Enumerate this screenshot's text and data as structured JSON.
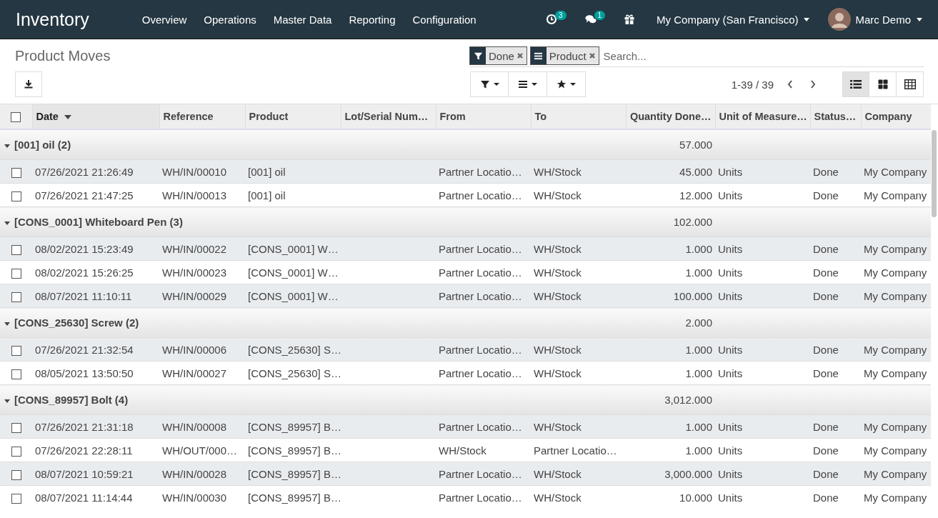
{
  "navbar": {
    "app_name": "Inventory",
    "menu": [
      "Overview",
      "Operations",
      "Master Data",
      "Reporting",
      "Configuration"
    ],
    "activity_count": "3",
    "message_count": "1",
    "company": "My Company (San Francisco)",
    "user": "Marc Demo"
  },
  "control_panel": {
    "title": "Product Moves",
    "facets": [
      {
        "kind": "filter",
        "label": "Done"
      },
      {
        "kind": "group",
        "label": "Product"
      }
    ],
    "search": {
      "placeholder": "Search..."
    },
    "pager": "1-39 / 39",
    "views": [
      {
        "kind": "list",
        "selected": true
      },
      {
        "kind": "kanban",
        "selected": false
      },
      {
        "kind": "pivot",
        "selected": false
      }
    ]
  },
  "table": {
    "select_all": {
      "checked": false
    },
    "columns": [
      {
        "label": "Date",
        "sorted": true
      },
      {
        "label": "Reference",
        "sorted": false
      },
      {
        "label": "Product",
        "sorted": false
      },
      {
        "label": "Lot/Serial Num…",
        "sorted": false
      },
      {
        "label": "From",
        "sorted": false
      },
      {
        "label": "To",
        "sorted": false
      },
      {
        "label": "Quantity Done…",
        "sorted": false
      },
      {
        "label": "Unit of Measure…",
        "sorted": false
      },
      {
        "label": "Status…",
        "sorted": false
      },
      {
        "label": "Company",
        "sorted": false
      }
    ],
    "groups": [
      {
        "label": "[001] oil (2)",
        "total": "57.000",
        "expanded": true,
        "rows": [
          {
            "checked": false,
            "date": "07/26/2021 21:26:49",
            "reference": "WH/IN/00010",
            "product": "[001] oil",
            "from": "Partner Locatio…",
            "to": "WH/Stock",
            "quantity": "45.000",
            "unit": "Units",
            "status": "Done",
            "company": "My Company"
          },
          {
            "checked": false,
            "date": "07/26/2021 21:47:25",
            "reference": "WH/IN/00013",
            "product": "[001] oil",
            "from": "Partner Locatio…",
            "to": "WH/Stock",
            "quantity": "12.000",
            "unit": "Units",
            "status": "Done",
            "company": "My Company"
          }
        ]
      },
      {
        "label": "[CONS_0001] Whiteboard Pen (3)",
        "total": "102.000",
        "expanded": true,
        "rows": [
          {
            "checked": false,
            "date": "08/02/2021 15:23:49",
            "reference": "WH/IN/00022",
            "product": "[CONS_0001] W…",
            "from": "Partner Locatio…",
            "to": "WH/Stock",
            "quantity": "1.000",
            "unit": "Units",
            "status": "Done",
            "company": "My Company"
          },
          {
            "checked": false,
            "date": "08/02/2021 15:26:25",
            "reference": "WH/IN/00023",
            "product": "[CONS_0001] W…",
            "from": "Partner Locatio…",
            "to": "WH/Stock",
            "quantity": "1.000",
            "unit": "Units",
            "status": "Done",
            "company": "My Company"
          },
          {
            "checked": false,
            "date": "08/07/2021 11:10:11",
            "reference": "WH/IN/00029",
            "product": "[CONS_0001] W…",
            "from": "Partner Locatio…",
            "to": "WH/Stock",
            "quantity": "100.000",
            "unit": "Units",
            "status": "Done",
            "company": "My Company"
          }
        ]
      },
      {
        "label": "[CONS_25630] Screw (2)",
        "total": "2.000",
        "expanded": true,
        "rows": [
          {
            "checked": false,
            "date": "07/26/2021 21:32:54",
            "reference": "WH/IN/00006",
            "product": "[CONS_25630] S…",
            "from": "Partner Locatio…",
            "to": "WH/Stock",
            "quantity": "1.000",
            "unit": "Units",
            "status": "Done",
            "company": "My Company"
          },
          {
            "checked": false,
            "date": "08/05/2021 13:50:50",
            "reference": "WH/IN/00027",
            "product": "[CONS_25630] S…",
            "from": "Partner Locatio…",
            "to": "WH/Stock",
            "quantity": "1.000",
            "unit": "Units",
            "status": "Done",
            "company": "My Company"
          }
        ]
      },
      {
        "label": "[CONS_89957] Bolt (4)",
        "total": "3,012.000",
        "expanded": true,
        "rows": [
          {
            "checked": false,
            "date": "07/26/2021 21:31:18",
            "reference": "WH/IN/00008",
            "product": "[CONS_89957] B…",
            "from": "Partner Locatio…",
            "to": "WH/Stock",
            "quantity": "1.000",
            "unit": "Units",
            "status": "Done",
            "company": "My Company"
          },
          {
            "checked": false,
            "date": "07/26/2021 22:28:11",
            "reference": "WH/OUT/000…",
            "product": "[CONS_89957] B…",
            "from": "WH/Stock",
            "to": "Partner Locatio…",
            "quantity": "1.000",
            "unit": "Units",
            "status": "Done",
            "company": "My Company"
          },
          {
            "checked": false,
            "date": "08/07/2021 10:59:21",
            "reference": "WH/IN/00028",
            "product": "[CONS_89957] B…",
            "from": "Partner Locatio…",
            "to": "WH/Stock",
            "quantity": "3,000.000",
            "unit": "Units",
            "status": "Done",
            "company": "My Company"
          },
          {
            "checked": false,
            "date": "08/07/2021 11:14:44",
            "reference": "WH/IN/00030",
            "product": "[CONS_89957] B…",
            "from": "Partner Locatio…",
            "to": "WH/Stock",
            "quantity": "10.000",
            "unit": "Units",
            "status": "Done",
            "company": "My Company"
          }
        ]
      }
    ]
  }
}
